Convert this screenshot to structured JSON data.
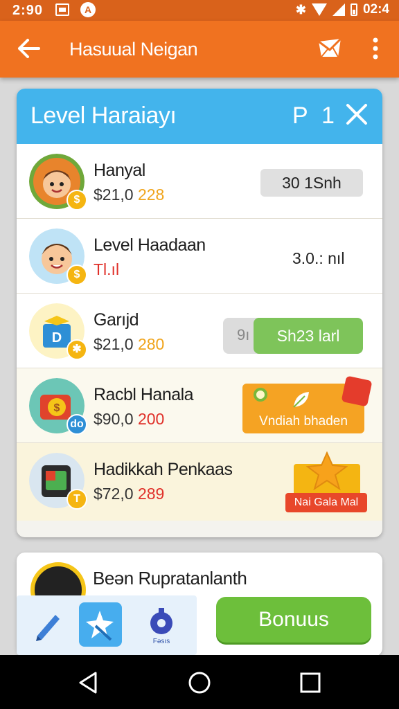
{
  "status_bar": {
    "time": "2:90",
    "right_time": "02:4"
  },
  "app_bar": {
    "title": "Hasuual Neigan",
    "back_icon": "arrow-left-icon",
    "mail_icon": "mail-icon",
    "more_icon": "more-vert-icon"
  },
  "card": {
    "title": "Level Haraiayı",
    "header_p": "P",
    "header_num": "1",
    "close_icon": "close-icon",
    "rows": [
      {
        "name": "Hanyal",
        "price_a": "$21,0 ",
        "price_b": "228",
        "price_b_color": "#f0a41b",
        "action": "30 1Snh",
        "avatar_color": "#e8842c",
        "coin": "$"
      },
      {
        "name": "Level Haadaan",
        "price_a": "",
        "price_b": "Tl.ıl",
        "price_b_color": "#e0312a",
        "action": "3.0.: nıl",
        "avatar_color": "#bfe3f6",
        "coin": "$"
      },
      {
        "name": "Garıjd",
        "price_a": "$21,0 ",
        "price_b": "280",
        "price_b_color": "#f0a41b",
        "action_ghost": "9ı",
        "action": "Sh23 larl",
        "avatar_color": "#fdf3c4",
        "coin": "✱"
      },
      {
        "name": "Racbl Hanala",
        "price_a": "$90,0 ",
        "price_b": "200",
        "price_b_color": "#e0312a",
        "action": "Vndiah bhaden",
        "avatar_color": "#dff0f2",
        "coin": "do"
      },
      {
        "name": "Hadikkah Penkaas",
        "price_a": "$72,0 ",
        "price_b": "289",
        "price_b_color": "#e0312a",
        "action": "Nai Gala Mal",
        "avatar_color": "#d9e6f0",
        "coin": "T"
      }
    ]
  },
  "card2": {
    "name": "Beən Rupratanlanth"
  },
  "tabs": {
    "t3_label": "Fəsıs"
  },
  "bonus_label": "Bonuus",
  "colors": {
    "accent": "#f07220",
    "header_blue": "#43b4ec",
    "green": "#6dbf3b"
  }
}
